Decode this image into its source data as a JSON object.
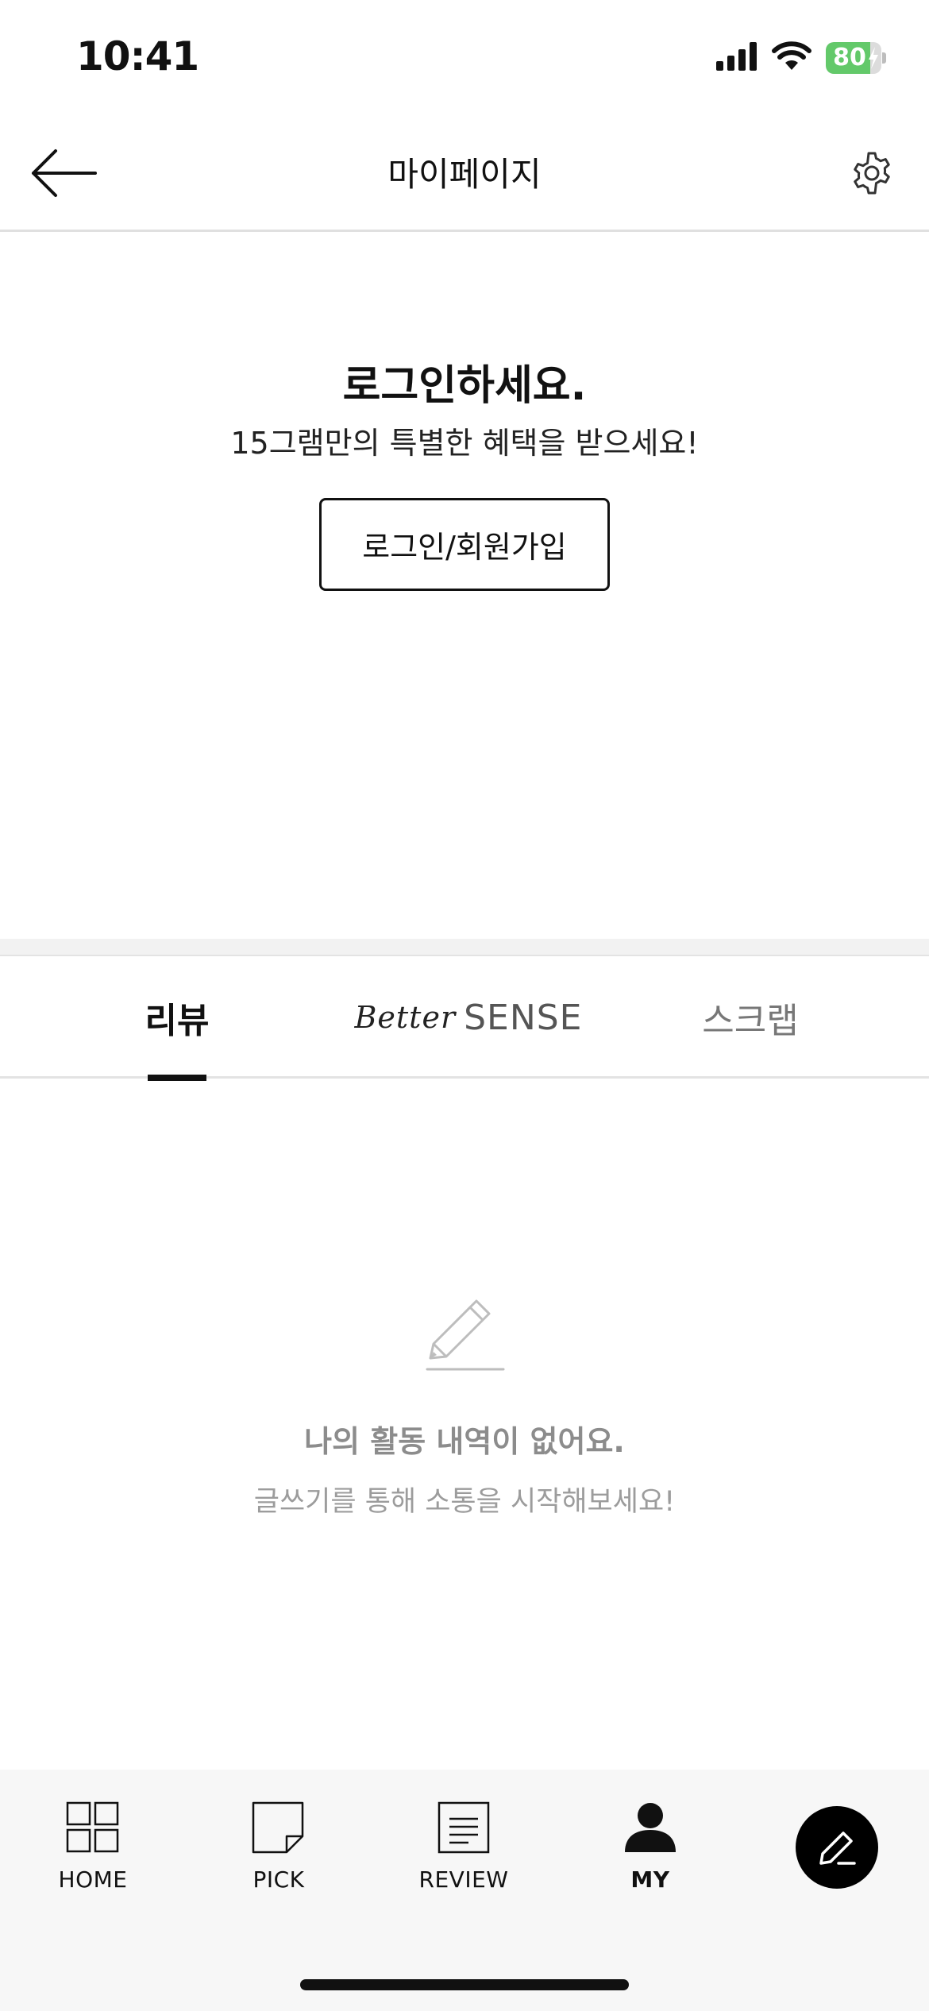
{
  "status_bar": {
    "time": "10:41",
    "battery_percent": "80",
    "battery_level": 0.8,
    "icons": [
      "signal-icon",
      "wifi-icon",
      "battery-icon"
    ]
  },
  "header": {
    "title": "마이페이지",
    "back_icon": "arrow-left-icon",
    "settings_icon": "gear-icon"
  },
  "login": {
    "heading": "로그인하세요.",
    "subtitle": "15그램만의 특별한 혜택을 받으세요!",
    "button_label": "로그인/회원가입"
  },
  "tabs": [
    {
      "label": "리뷰",
      "active": true
    },
    {
      "label_script": "Better",
      "label": "SENSE",
      "active": false
    },
    {
      "label": "스크랩",
      "active": false
    }
  ],
  "empty_state": {
    "icon": "pencil-icon",
    "title": "나의 활동 내역이 없어요.",
    "subtitle": "글쓰기를 통해 소통을 시작해보세요!"
  },
  "bottom_nav": {
    "items": [
      {
        "label": "HOME",
        "icon": "grid-icon",
        "active": false
      },
      {
        "label": "PICK",
        "icon": "note-icon",
        "active": false
      },
      {
        "label": "REVIEW",
        "icon": "document-icon",
        "active": false
      },
      {
        "label": "MY",
        "icon": "person-icon",
        "active": true
      }
    ],
    "write_icon": "edit-pen-icon"
  },
  "colors": {
    "accent": "#000000",
    "battery": "#63c96a",
    "muted_text": "#8c8c8c",
    "divider": "#e0e0e0"
  }
}
